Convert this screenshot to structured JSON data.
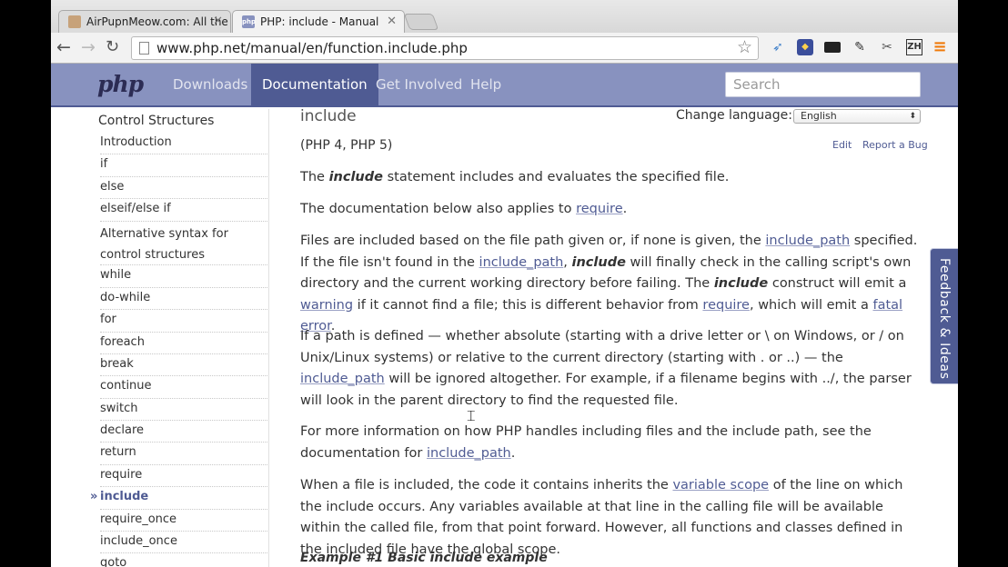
{
  "browser": {
    "tabs": [
      {
        "title": "AirPupnMeow.com: All the"
      },
      {
        "title": "PHP: include - Manual"
      }
    ],
    "tab_close_glyph": "✕",
    "url": "www.php.net/manual/en/function.include.php",
    "favicon_php": "php"
  },
  "header": {
    "logo": "php",
    "nav": [
      "Downloads",
      "Documentation",
      "Get Involved",
      "Help"
    ],
    "search_placeholder": "Search",
    "brand_color": "#8892bf",
    "active_color": "#4f5b93"
  },
  "sidebar": {
    "title": "Control Structures",
    "items": [
      "Introduction",
      "if",
      "else",
      "elseif/else if",
      "Alternative syntax for control structures",
      "while",
      "do-while",
      "for",
      "foreach",
      "break",
      "continue",
      "switch",
      "declare",
      "return",
      "require",
      "include",
      "require_once",
      "include_once",
      "goto"
    ],
    "active_item": "include"
  },
  "content": {
    "title": "include",
    "change_language_label": "Change language:",
    "language": "English",
    "versions": "(PHP 4, PHP 5)",
    "edit": "Edit",
    "report_bug": "Report a Bug",
    "p1": {
      "a": "The ",
      "em": "include",
      "b": " statement includes and evaluates the specified file."
    },
    "p2": {
      "a": "The documentation below also applies to ",
      "link": "require",
      "b": "."
    },
    "p3": {
      "a": "Files are included based on the file path given or, if none is given, the ",
      "link1": "include_path",
      "b": " specified. If the file isn't found in the ",
      "link2": "include_path",
      "c": ", ",
      "em1": "include",
      "d": " will finally check in the calling script's own directory and the current working directory before failing. The ",
      "em2": "include",
      "e": " construct will emit a ",
      "link3": "warning",
      "f": " if it cannot find a file; this is different behavior from ",
      "link4": "require",
      "g": ", which will emit a ",
      "link5": "fatal error",
      "h": "."
    },
    "p4": {
      "a": "If a path is defined — whether absolute (starting with a drive letter or \\ on Windows, or / on Unix/Linux systems) or relative to the current directory (starting with . or ..) — the ",
      "link": "include_path",
      "b": " will be ignored altogether. For example, if a filename begins with ../, the parser will look in the parent directory to find the requested file."
    },
    "p5": {
      "a": "For more information on how PHP handles including files and the include path, see the documentation for ",
      "link": "include_path",
      "b": "."
    },
    "p6": {
      "a": "When a file is included, the code it contains inherits the ",
      "link": "variable scope",
      "b": " of the line on which the include occurs. Any variables available at that line in the calling file will be available within the called file, from that point forward. However, all functions and classes defined in the included file have the global scope."
    },
    "example_heading": "Example #1 Basic include example"
  },
  "feedback": "Feedback & Ideas"
}
